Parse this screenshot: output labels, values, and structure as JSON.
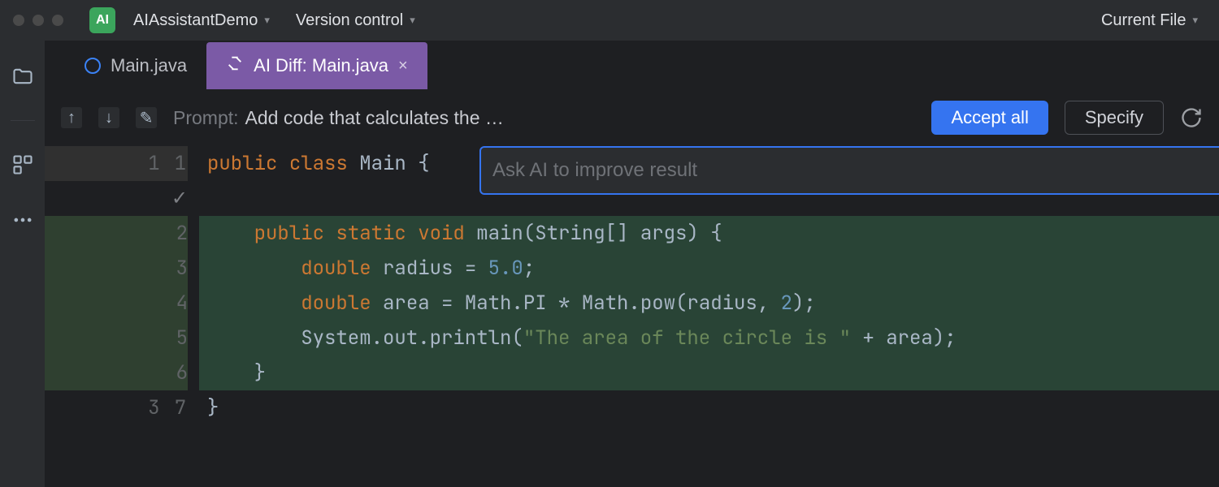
{
  "titlebar": {
    "logo_text": "AI",
    "project_name": "AIAssistantDemo",
    "vcs_label": "Version control",
    "scope_label": "Current File"
  },
  "tabs": [
    {
      "label": "Main.java",
      "kind": "file",
      "active": false
    },
    {
      "label": "AI Diff: Main.java",
      "kind": "diff",
      "active": true,
      "closable": true
    }
  ],
  "action_bar": {
    "prompt_label": "Prompt:",
    "prompt_value": "Add code that calculates the …",
    "accept_label": "Accept all",
    "specify_label": "Specify"
  },
  "ask_popup": {
    "placeholder": "Ask AI to improve result"
  },
  "editor": {
    "lines": [
      {
        "left": "1",
        "right": "1",
        "status": "context-top",
        "tokens": [
          [
            "kw",
            "public "
          ],
          [
            "kw",
            "class "
          ],
          [
            "type",
            "Main "
          ],
          [
            "ident",
            "{"
          ]
        ]
      },
      {
        "left": "",
        "right": "",
        "status": "check",
        "check": true,
        "tokens": []
      },
      {
        "left": "",
        "right": "2",
        "status": "added",
        "tokens": [
          [
            "ident",
            "    "
          ],
          [
            "kw",
            "public "
          ],
          [
            "kw",
            "static "
          ],
          [
            "kw",
            "void "
          ],
          [
            "ident",
            "main(String[] args) {"
          ]
        ]
      },
      {
        "left": "",
        "right": "3",
        "status": "added",
        "tokens": [
          [
            "ident",
            "        "
          ],
          [
            "kw",
            "double "
          ],
          [
            "ident",
            "radius = "
          ],
          [
            "num",
            "5.0"
          ],
          [
            "ident",
            ";"
          ]
        ]
      },
      {
        "left": "",
        "right": "4",
        "status": "added",
        "tokens": [
          [
            "ident",
            "        "
          ],
          [
            "kw",
            "double "
          ],
          [
            "ident",
            "area = Math.PI * Math.pow(radius, "
          ],
          [
            "num",
            "2"
          ],
          [
            "ident",
            ");"
          ]
        ]
      },
      {
        "left": "",
        "right": "5",
        "status": "added",
        "tokens": [
          [
            "ident",
            "        System.out.println("
          ],
          [
            "str",
            "\"The area of the circle is \""
          ],
          [
            "ident",
            " + area);"
          ]
        ]
      },
      {
        "left": "",
        "right": "6",
        "status": "added",
        "tokens": [
          [
            "ident",
            "    }"
          ]
        ]
      },
      {
        "left": "3",
        "right": "7",
        "status": "context",
        "tokens": [
          [
            "ident",
            "}"
          ]
        ]
      }
    ]
  }
}
